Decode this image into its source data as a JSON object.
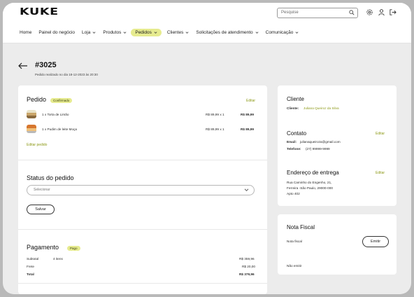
{
  "header": {
    "logo": "KUKE",
    "search_placeholder": "Pesquise"
  },
  "nav": {
    "items": [
      {
        "label": "Home",
        "dropdown": false
      },
      {
        "label": "Painel do negócio",
        "dropdown": false
      },
      {
        "label": "Loja",
        "dropdown": true
      },
      {
        "label": "Produtos",
        "dropdown": true
      },
      {
        "label": "Pedidos",
        "dropdown": true,
        "active": true
      },
      {
        "label": "Clientes",
        "dropdown": true
      },
      {
        "label": "Solicitações de atendimento",
        "dropdown": true
      },
      {
        "label": "Comunicação",
        "dropdown": true
      }
    ]
  },
  "order": {
    "number": "#3025",
    "subtitle": "Pedido realizado no dia 18-12-2023  às  20:30"
  },
  "pedido": {
    "title": "Pedido",
    "status": "Confirmado",
    "edit": "Editar",
    "items": [
      {
        "desc": "1 x Torta de Limão",
        "unit": "R$ 89,99 x 1",
        "total": "R$ 89,99"
      },
      {
        "desc": "1 x Pudim de leite Moça",
        "unit": "R$ 89,99 x 1",
        "total": "R$ 89,99"
      }
    ],
    "edit_order": "Editar pedido"
  },
  "status_section": {
    "title": "Status do pedido",
    "select_placeholder": "Selecionar",
    "save": "Salvar"
  },
  "pagamento": {
    "title": "Pagamento",
    "badge": "Pago",
    "subtotal_label": "Subtotal",
    "subtotal_items": "4 itens",
    "subtotal_value": "R$ 359,96",
    "frete_label": "Frete",
    "frete_value": "R$ 20,00",
    "total_label": "Total",
    "total_value": "R$ 379,96"
  },
  "cliente": {
    "title": "Cliente",
    "label": "Cliente:",
    "name": "Juliana Queiroz da Silva"
  },
  "contato": {
    "title": "Contato",
    "edit": "Editar",
    "email_label": "Email:",
    "email": "julianaqueiroza@gmail.com",
    "phone_label": "Telefone:",
    "phone": "(27) 99999-9999"
  },
  "endereco": {
    "title": "Endereço de entrega",
    "edit": "Editar",
    "line1": "Rua Caminho do Engenho, 21,",
    "line2": "Ferreira -São Paulo, 29000-000",
    "line3": "Apto 402"
  },
  "nota": {
    "title": "Nota Fiscal",
    "label": "Nota fiscal",
    "emit": "Emitir",
    "status": "Não emitir"
  },
  "colors": {
    "accent": "#e6eb8f",
    "accent_text": "#8d9a18",
    "background": "#ececec"
  }
}
